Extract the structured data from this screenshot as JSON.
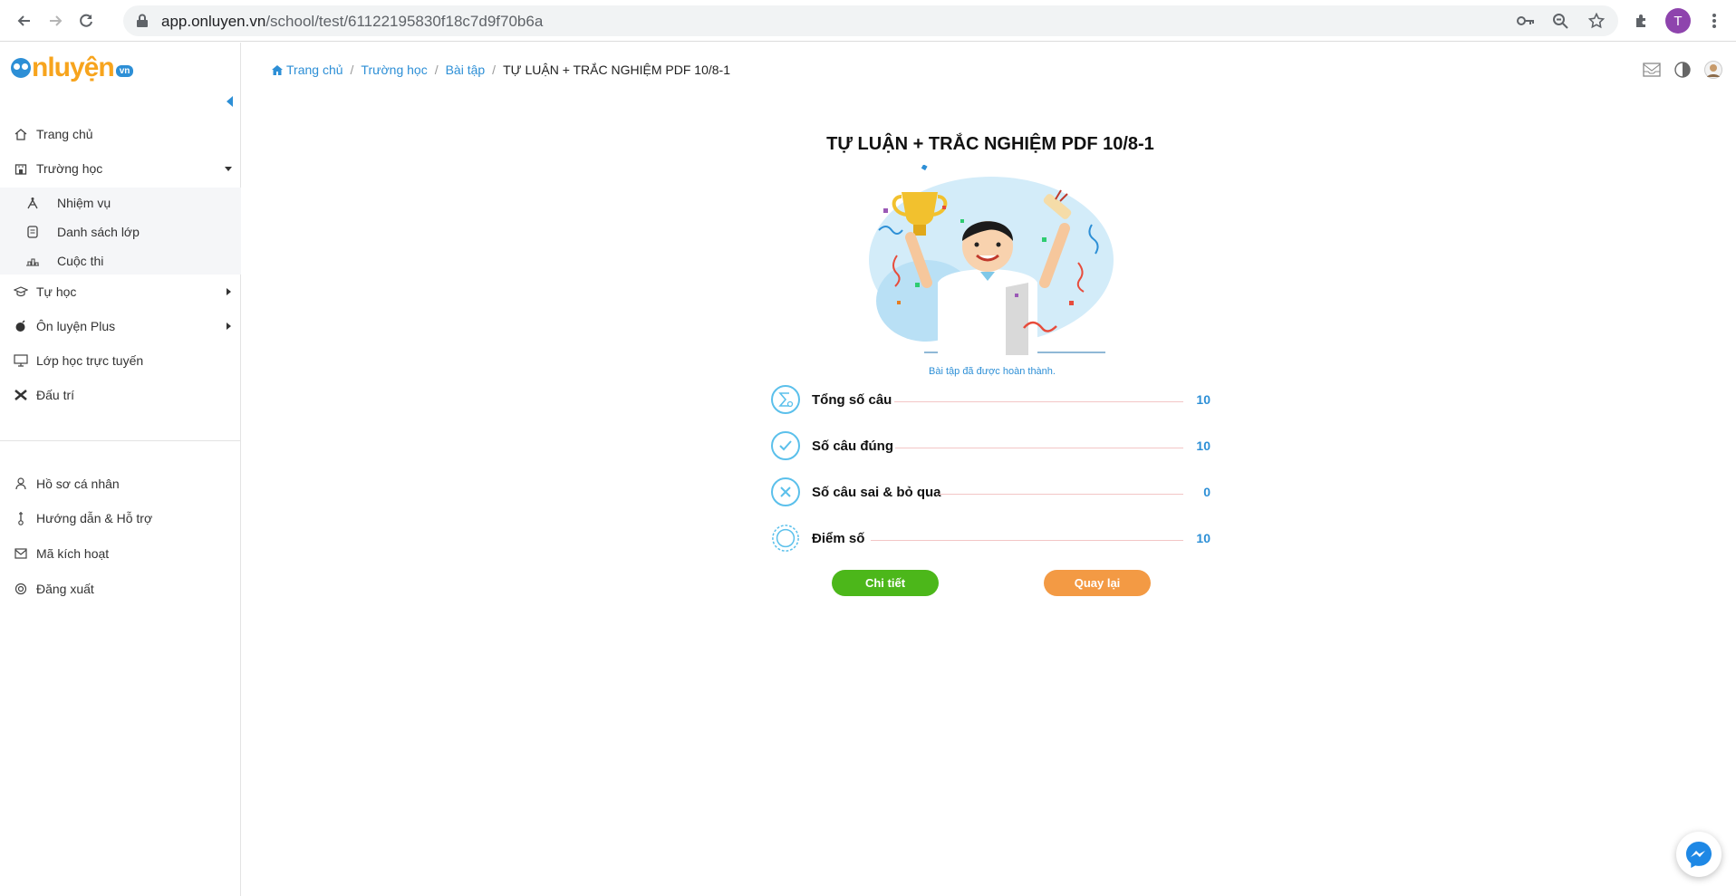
{
  "browser": {
    "url_host": "app.onluyen.vn",
    "url_path": "/school/test/61122195830f18c7d9f70b6a",
    "profile_initial": "T"
  },
  "sidebar": {
    "logo": {
      "word": "nluyện",
      "suffix": "vn"
    },
    "items": [
      {
        "label": "Trang chủ",
        "icon": "home-icon"
      },
      {
        "label": "Trường học",
        "icon": "school-icon"
      },
      {
        "label": "Tự học",
        "icon": "graduation-cap-icon"
      },
      {
        "label": "Ôn luyện Plus",
        "icon": "plus-bomb-icon"
      },
      {
        "label": "Lớp học trực tuyến",
        "icon": "monitor-icon"
      },
      {
        "label": "Đấu trí",
        "icon": "battle-icon"
      }
    ],
    "school_sub": [
      {
        "label": "Nhiệm vụ",
        "icon": "task-icon"
      },
      {
        "label": "Danh sách lớp",
        "icon": "class-list-icon"
      },
      {
        "label": "Cuộc thi",
        "icon": "contest-icon"
      }
    ],
    "bottom": [
      {
        "label": "Hồ sơ cá nhân",
        "icon": "user-icon"
      },
      {
        "label": "Hướng dẫn & Hỗ trợ",
        "icon": "guide-icon"
      },
      {
        "label": "Mã kích hoạt",
        "icon": "mail-icon"
      },
      {
        "label": "Đăng xuất",
        "icon": "logout-icon"
      }
    ]
  },
  "breadcrumb": {
    "home": "Trang chủ",
    "school": "Trường học",
    "exercise": "Bài tập",
    "sep": "/",
    "current": "TỰ LUẬN + TRẮC NGHIỆM PDF 10/8-1"
  },
  "result": {
    "title": "TỰ LUẬN + TRẮC NGHIỆM PDF 10/8-1",
    "completed_text": "Bài tập đã được hoàn thành.",
    "stats": [
      {
        "label": "Tổng số câu",
        "value": "10",
        "icon": "sigma-icon"
      },
      {
        "label": "Số câu đúng",
        "value": "10",
        "icon": "check-icon"
      },
      {
        "label": "Số câu sai & bỏ qua",
        "value": "0",
        "icon": "cross-icon"
      },
      {
        "label": "Điểm số",
        "value": "10",
        "icon": "medal-icon"
      }
    ],
    "detail_button": "Chi tiết",
    "back_button": "Quay lại"
  },
  "colors": {
    "accent": "#2d8fd6",
    "green": "#4cb71a",
    "orange": "#f39a44"
  }
}
